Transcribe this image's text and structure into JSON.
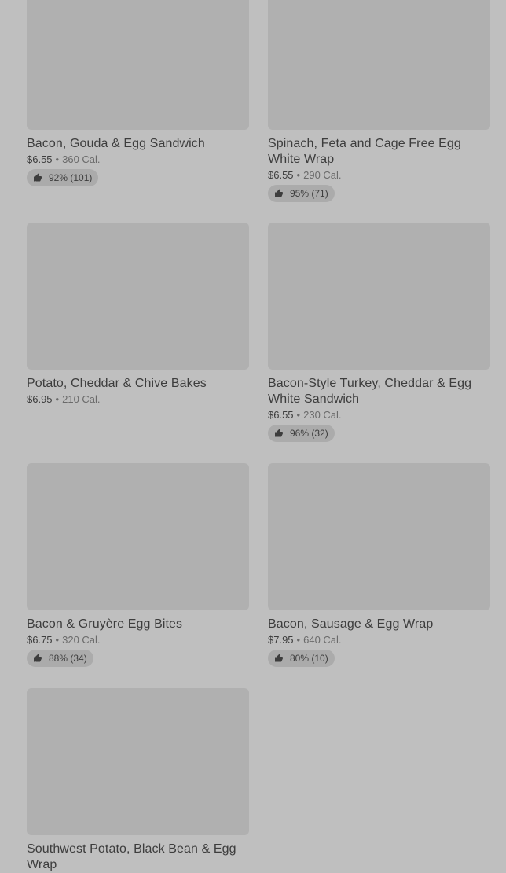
{
  "menu": {
    "items": [
      {
        "name": "Bacon, Gouda & Egg Sandwich",
        "price": "$6.55",
        "sep": "•",
        "calories": "360 Cal.",
        "rating": "92% (101)",
        "lines": 1
      },
      {
        "name": "Spinach, Feta and Cage Free Egg White Wrap",
        "price": "$6.55",
        "sep": "•",
        "calories": "290 Cal.",
        "rating": "95% (71)",
        "lines": 2
      },
      {
        "name": "Potato, Cheddar & Chive Bakes",
        "price": "$6.95",
        "sep": "•",
        "calories": "210 Cal.",
        "rating": null,
        "lines": 1
      },
      {
        "name": "Bacon-Style Turkey, Cheddar & Egg White Sandwich",
        "price": "$6.55",
        "sep": "•",
        "calories": "230 Cal.",
        "rating": "96% (32)",
        "lines": 2
      },
      {
        "name": "Bacon & Gruyère Egg Bites",
        "price": "$6.75",
        "sep": "•",
        "calories": "320 Cal.",
        "rating": "88% (34)",
        "lines": 1
      },
      {
        "name": "Bacon, Sausage & Egg Wrap",
        "price": "$7.95",
        "sep": "•",
        "calories": "640 Cal.",
        "rating": "80% (10)",
        "lines": 1
      },
      {
        "name": "Southwest Potato, Black Bean & Egg Wrap",
        "price": "",
        "sep": "",
        "calories": "",
        "rating": null,
        "lines": 2
      }
    ]
  },
  "icons": {
    "rating": "thumbs-up-icon"
  },
  "colors": {
    "background": "#bfbfbf",
    "image_placeholder": "#b0b0b0",
    "text": "#3d3d3d",
    "muted_text": "#6a6a6a",
    "rating_pill": "#ababab"
  }
}
